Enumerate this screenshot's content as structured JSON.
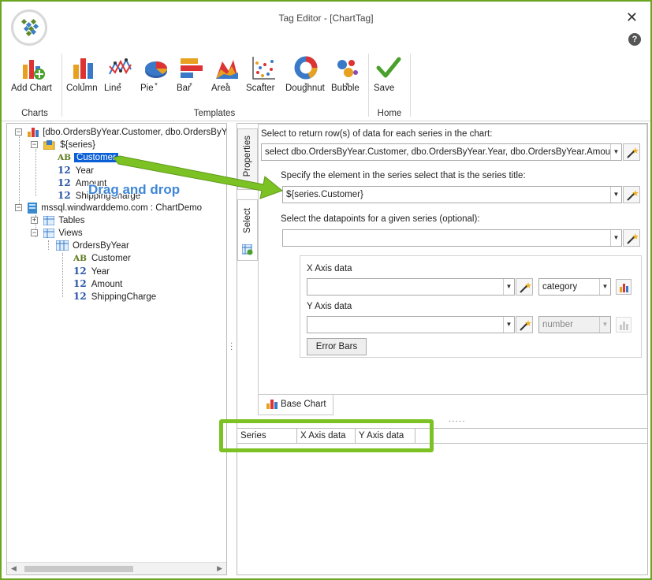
{
  "window": {
    "title": "Tag Editor - [ChartTag]",
    "close_glyph": "✕",
    "help_glyph": "?"
  },
  "ribbon": {
    "buttons": [
      {
        "label": "Add Chart",
        "icon": "add-chart-icon"
      },
      {
        "label": "Column",
        "icon": "column-chart-icon"
      },
      {
        "label": "Line",
        "icon": "line-chart-icon"
      },
      {
        "label": "Pie",
        "icon": "pie-chart-icon"
      },
      {
        "label": "Bar",
        "icon": "bar-chart-icon"
      },
      {
        "label": "Area",
        "icon": "area-chart-icon"
      },
      {
        "label": "Scatter",
        "icon": "scatter-chart-icon"
      },
      {
        "label": "Doughnut",
        "icon": "doughnut-chart-icon"
      },
      {
        "label": "Bubble",
        "icon": "bubble-chart-icon"
      },
      {
        "label": "Save",
        "icon": "checkmark-icon"
      }
    ],
    "dropdown_glyph": "▾",
    "groups": {
      "charts": "Charts",
      "templates": "Templates",
      "home": "Home"
    }
  },
  "tree": {
    "root": "[dbo.OrdersByYear.Customer, dbo.OrdersByYear.Year, dbo.OrdersByYear.Amount, dbo.OrdersByYear.ShippingCharge]",
    "series": "${series}",
    "series_fields": [
      "Customer",
      "Year",
      "Amount",
      "ShippingCharge"
    ],
    "datasource": "mssql.windwarddemo.com : ChartDemo",
    "tables": "Tables",
    "views": "Views",
    "view_name": "OrdersByYear",
    "view_fields": [
      "Customer",
      "Year",
      "Amount",
      "ShippingCharge"
    ],
    "ab_glyph": "AB",
    "num_glyph": "12",
    "plus": "+",
    "minus": "−"
  },
  "tabs": {
    "properties": "Properties",
    "select": "Select",
    "base_chart": "Base Chart"
  },
  "select_panel": {
    "rows_label": "Select to return row(s) of data for each series in the chart:",
    "rows_value": "select dbo.OrdersByYear.Customer, dbo.OrdersByYear.Year, dbo.OrdersByYear.Amount, dbo.OrdersByYear.ShippingCharge",
    "title_label": "Specify the element in the series select that is the series title:",
    "title_value": "${series.Customer}",
    "datapoints_label": "Select the datapoints for a given series (optional):",
    "datapoints_value": "",
    "x_axis_label": "X Axis data",
    "x_axis_value": "",
    "x_axis_type": "category",
    "y_axis_label": "Y Axis data",
    "y_axis_value": "",
    "y_axis_type": "number",
    "error_bars": "Error Bars",
    "arrow_glyph": "▼"
  },
  "grid": {
    "columns": [
      "Series",
      "X Axis data",
      "Y Axis data"
    ]
  },
  "annotation": {
    "drag_text": "Drag and drop",
    "accent": "#7cc224"
  },
  "colors": {
    "selection": "#0a5fd6",
    "accent_border": "#6aa621"
  }
}
